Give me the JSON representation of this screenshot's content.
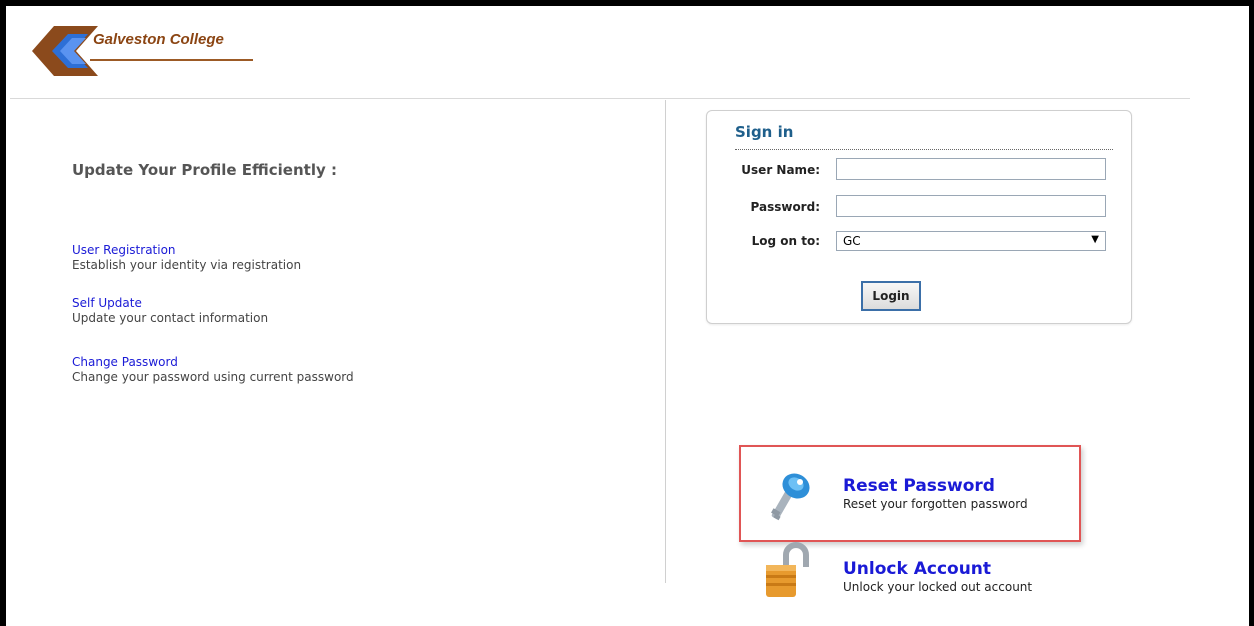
{
  "header": {
    "logo_text": "Galveston College"
  },
  "left_panel": {
    "title": "Update Your Profile Efficiently :",
    "links": [
      {
        "label": "User Registration",
        "description": "Establish your identity via registration"
      },
      {
        "label": "Self Update",
        "description": "Update your contact information"
      },
      {
        "label": "Change Password",
        "description": "Change your password using current password"
      }
    ]
  },
  "signin": {
    "title": "Sign in",
    "username_label": "User Name:",
    "username_value": "",
    "password_label": "Password:",
    "password_value": "",
    "logon_label": "Log on to:",
    "logon_selected": "GC",
    "login_button": "Login"
  },
  "actions": {
    "reset": {
      "title": "Reset Password",
      "description": "Reset your forgotten password"
    },
    "unlock": {
      "title": "Unlock Account",
      "description": "Unlock your locked out account"
    }
  },
  "colors": {
    "link_blue": "#1a1ad6",
    "signin_title": "#1f5f8b",
    "highlight_red": "#e05555",
    "logo_brown": "#8b4513"
  }
}
